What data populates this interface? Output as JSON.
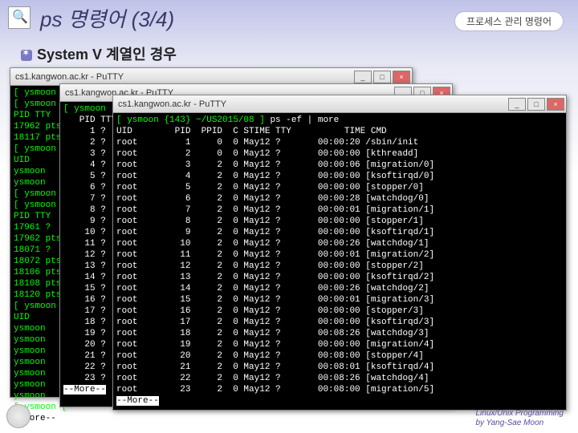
{
  "header": {
    "title": "ps 명령어 (3/4)",
    "tag": "프로세스 관리 명령어",
    "subtitle": "System V 계열인 경우"
  },
  "footer": {
    "line1": "Linux/Unix Programming",
    "line2": "by Yang-Sae Moon"
  },
  "windows": {
    "back_left": {
      "title": "cs1.kangwon.ac.kr - PuTTY"
    },
    "back_mid": {
      "title": "cs1.kangwon.ac.kr - PuTTY"
    },
    "front": {
      "title": "cs1.kangwon.ac.kr - PuTTY"
    }
  },
  "term_back_left": {
    "prompts": [
      "[ ysmoon {135",
      "[ ysmoon {",
      "PID TTY",
      "17962 pts/",
      "18117 pts/",
      "[ ysmoon {",
      "UID",
      "ysmoon   1",
      "ysmoon   1",
      "[ ysmoon {",
      "[ ysmoon {",
      "PID TTY",
      "17961 ?",
      "17962 pts/",
      "18071 ?",
      "18072 pts/",
      "18106 pts/",
      "18108 pts/",
      "18120 pts/",
      "[ ysmoon {",
      "UID",
      "ysmoon   1",
      "ysmoon   1",
      "ysmoon   1",
      "ysmoon   1",
      "ysmoon   1",
      "ysmoon   1",
      "ysmoon   1",
      "[ ysmoon {"
    ],
    "more": "--More--"
  },
  "term_back_mid": {
    "prompt": "[ ysmoon {144",
    "pids": [
      "PID TTY",
      "1 ?",
      "2 ?",
      "3 ?",
      "4 ?",
      "5 ?",
      "6 ?",
      "7 ?",
      "8 ?",
      "9 ?",
      "10 ?",
      "11 ?",
      "12 ?",
      "13 ?",
      "14 ?",
      "15 ?",
      "16 ?",
      "17 ?",
      "18 ?",
      "19 ?",
      "20 ?",
      "21 ?",
      "22 ?",
      "23 ?"
    ],
    "more": "--More--"
  },
  "term_front": {
    "cmd_prefix": "[ ysmoon {143} ~/US2015/08 ] ",
    "cmd": "ps -ef | more",
    "header": "UID        PID  PPID  C STIME TTY          TIME CMD",
    "rows": [
      {
        "uid": "root",
        "pid": "1",
        "ppid": "0",
        "c": "0",
        "stime": "May12",
        "tty": "?",
        "time": "00:00:20",
        "cmd": "/sbin/init"
      },
      {
        "uid": "root",
        "pid": "2",
        "ppid": "0",
        "c": "0",
        "stime": "May12",
        "tty": "?",
        "time": "00:00:00",
        "cmd": "[kthreadd]"
      },
      {
        "uid": "root",
        "pid": "3",
        "ppid": "2",
        "c": "0",
        "stime": "May12",
        "tty": "?",
        "time": "00:00:06",
        "cmd": "[migration/0]"
      },
      {
        "uid": "root",
        "pid": "4",
        "ppid": "2",
        "c": "0",
        "stime": "May12",
        "tty": "?",
        "time": "00:00:00",
        "cmd": "[ksoftirqd/0]"
      },
      {
        "uid": "root",
        "pid": "5",
        "ppid": "2",
        "c": "0",
        "stime": "May12",
        "tty": "?",
        "time": "00:00:00",
        "cmd": "[stopper/0]"
      },
      {
        "uid": "root",
        "pid": "6",
        "ppid": "2",
        "c": "0",
        "stime": "May12",
        "tty": "?",
        "time": "00:00:28",
        "cmd": "[watchdog/0]"
      },
      {
        "uid": "root",
        "pid": "7",
        "ppid": "2",
        "c": "0",
        "stime": "May12",
        "tty": "?",
        "time": "00:00:01",
        "cmd": "[migration/1]"
      },
      {
        "uid": "root",
        "pid": "8",
        "ppid": "2",
        "c": "0",
        "stime": "May12",
        "tty": "?",
        "time": "00:00:00",
        "cmd": "[stopper/1]"
      },
      {
        "uid": "root",
        "pid": "9",
        "ppid": "2",
        "c": "0",
        "stime": "May12",
        "tty": "?",
        "time": "00:00:00",
        "cmd": "[ksoftirqd/1]"
      },
      {
        "uid": "root",
        "pid": "10",
        "ppid": "2",
        "c": "0",
        "stime": "May12",
        "tty": "?",
        "time": "00:00:26",
        "cmd": "[watchdog/1]"
      },
      {
        "uid": "root",
        "pid": "11",
        "ppid": "2",
        "c": "0",
        "stime": "May12",
        "tty": "?",
        "time": "00:00:01",
        "cmd": "[migration/2]"
      },
      {
        "uid": "root",
        "pid": "12",
        "ppid": "2",
        "c": "0",
        "stime": "May12",
        "tty": "?",
        "time": "00:00:00",
        "cmd": "[stopper/2]"
      },
      {
        "uid": "root",
        "pid": "13",
        "ppid": "2",
        "c": "0",
        "stime": "May12",
        "tty": "?",
        "time": "00:00:00",
        "cmd": "[ksoftirqd/2]"
      },
      {
        "uid": "root",
        "pid": "14",
        "ppid": "2",
        "c": "0",
        "stime": "May12",
        "tty": "?",
        "time": "00:00:26",
        "cmd": "[watchdog/2]"
      },
      {
        "uid": "root",
        "pid": "15",
        "ppid": "2",
        "c": "0",
        "stime": "May12",
        "tty": "?",
        "time": "00:00:01",
        "cmd": "[migration/3]"
      },
      {
        "uid": "root",
        "pid": "16",
        "ppid": "2",
        "c": "0",
        "stime": "May12",
        "tty": "?",
        "time": "00:00:00",
        "cmd": "[stopper/3]"
      },
      {
        "uid": "root",
        "pid": "17",
        "ppid": "2",
        "c": "0",
        "stime": "May12",
        "tty": "?",
        "time": "00:00:00",
        "cmd": "[ksoftirqd/3]"
      },
      {
        "uid": "root",
        "pid": "18",
        "ppid": "2",
        "c": "0",
        "stime": "May12",
        "tty": "?",
        "time": "00:08:26",
        "cmd": "[watchdog/3]"
      },
      {
        "uid": "root",
        "pid": "19",
        "ppid": "2",
        "c": "0",
        "stime": "May12",
        "tty": "?",
        "time": "00:00:00",
        "cmd": "[migration/4]"
      },
      {
        "uid": "root",
        "pid": "20",
        "ppid": "2",
        "c": "0",
        "stime": "May12",
        "tty": "?",
        "time": "00:08:00",
        "cmd": "[stopper/4]"
      },
      {
        "uid": "root",
        "pid": "21",
        "ppid": "2",
        "c": "0",
        "stime": "May12",
        "tty": "?",
        "time": "00:08:01",
        "cmd": "[ksoftirqd/4]"
      },
      {
        "uid": "root",
        "pid": "22",
        "ppid": "2",
        "c": "0",
        "stime": "May12",
        "tty": "?",
        "time": "00:08:26",
        "cmd": "[watchdog/4]"
      },
      {
        "uid": "root",
        "pid": "23",
        "ppid": "2",
        "c": "0",
        "stime": "May12",
        "tty": "?",
        "time": "00:08:00",
        "cmd": "[migration/5]"
      }
    ],
    "more": "--More--"
  }
}
